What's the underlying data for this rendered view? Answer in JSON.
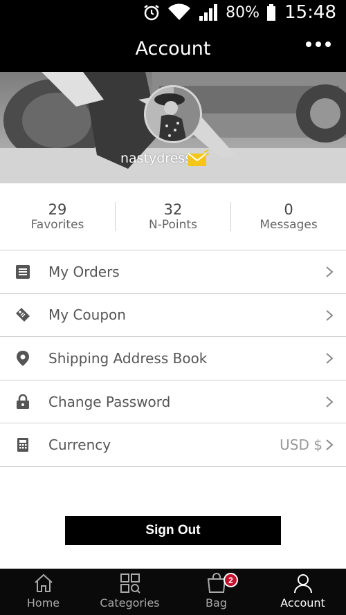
{
  "status_bar": {
    "icons": [
      "alarm-icon",
      "wifi-icon",
      "signal-icon",
      "battery-icon"
    ],
    "battery": "80%",
    "time": "15:48"
  },
  "header": {
    "title": "Account",
    "more_icon": "more-dots-icon"
  },
  "profile": {
    "username": "nastydress",
    "mail_icon": "mail-icon",
    "mail_color": "#f5c518"
  },
  "stats": [
    {
      "value": "29",
      "label": "Favorites"
    },
    {
      "value": "32",
      "label": "N-Points"
    },
    {
      "value": "0",
      "label": "Messages"
    }
  ],
  "menu": [
    {
      "icon": "orders-icon",
      "label": "My Orders",
      "value": ""
    },
    {
      "icon": "coupon-tag-icon",
      "label": "My Coupon",
      "value": ""
    },
    {
      "icon": "location-pin-icon",
      "label": "Shipping Address Book",
      "value": ""
    },
    {
      "icon": "lock-icon",
      "label": "Change Password",
      "value": ""
    },
    {
      "icon": "calculator-icon",
      "label": "Currency",
      "value": "USD $"
    }
  ],
  "sign_out": "Sign Out",
  "tabbar": {
    "tabs": [
      {
        "icon": "home-icon",
        "label": "Home",
        "active": false
      },
      {
        "icon": "categories-icon",
        "label": "Categories",
        "active": false
      },
      {
        "icon": "bag-icon",
        "label": "Bag",
        "active": false,
        "badge": "2"
      },
      {
        "icon": "account-icon",
        "label": "Account",
        "active": true
      }
    ],
    "badge_color": "#c8102e"
  }
}
